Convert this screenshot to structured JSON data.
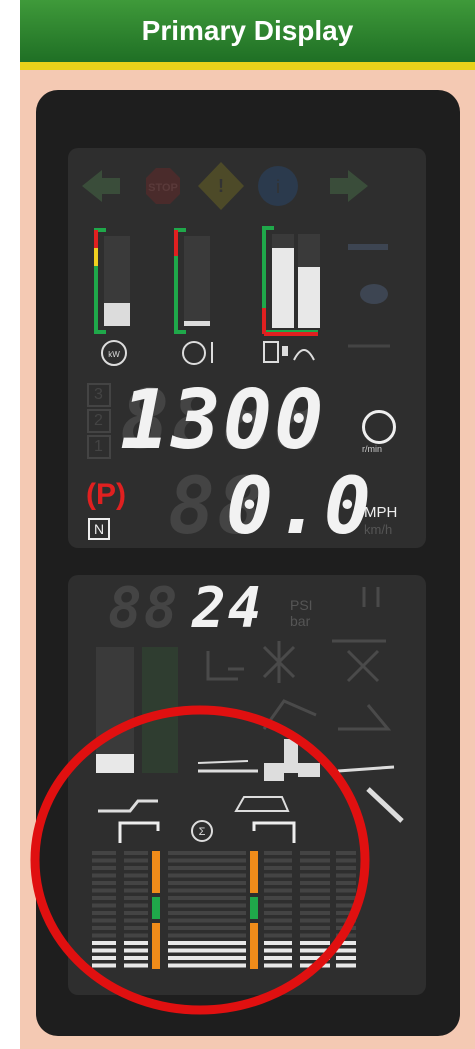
{
  "title": "Primary Display",
  "readouts": {
    "engine_speed": "1300",
    "speed_ghost": "8888",
    "engine_speed_unit": "r/min",
    "ground_speed": "0.0",
    "ground_speed_ghost": "88",
    "speed_unit_primary": "MPH",
    "speed_unit_secondary": "km/h",
    "gear_digits": [
      "3",
      "2",
      "1"
    ],
    "park_label": "(P)",
    "neutral_label": "N",
    "pressure": "24",
    "pressure_ghost": "88",
    "pressure_unit_primary": "PSI",
    "pressure_unit_secondary": "bar"
  },
  "icons": [
    "left-turn-icon",
    "stop-icon",
    "warning-icon",
    "info-icon",
    "right-turn-icon",
    "high-beam-icon",
    "coolant-level-icon",
    "engine-load-icon",
    "engine-temp-icon",
    "fuel-icon",
    "def-icon"
  ],
  "gauges": {
    "engine_load_level": 0.25,
    "coolant_temp_level": 0.05,
    "fuel_level": 0.85,
    "def_level": 0.65,
    "left_bar_level": 0.15
  },
  "colors": {
    "green": "#1fa84a",
    "red": "#e02020",
    "yellow": "#f0d020",
    "orange": "#f08c1a",
    "annotation": "#e01010"
  }
}
